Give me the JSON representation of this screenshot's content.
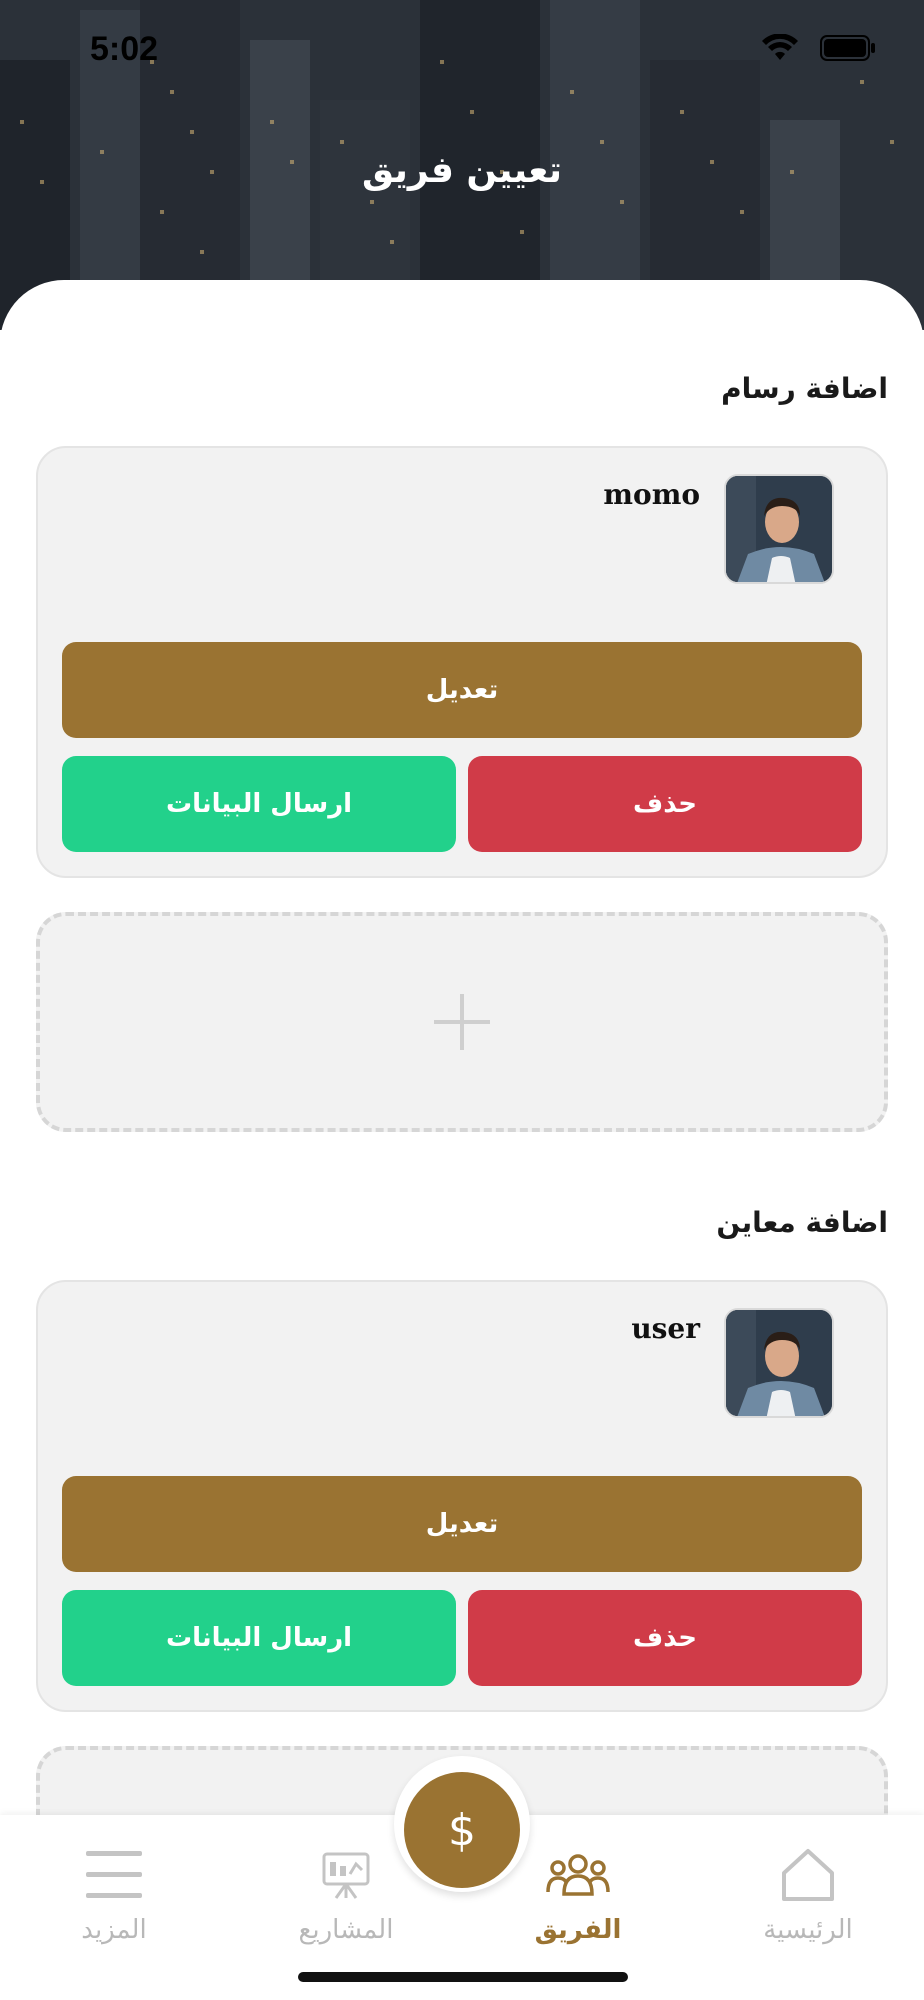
{
  "status_bar": {
    "time": "5:02"
  },
  "header": {
    "title": "تعيين فريق"
  },
  "sections": [
    {
      "title": "اضافة رسام",
      "member": {
        "name": "momo",
        "edit_label": "تعديل",
        "send_label": "ارسال البيانات",
        "delete_label": "حذف"
      }
    },
    {
      "title": "اضافة معاين",
      "member": {
        "name": "user",
        "edit_label": "تعديل",
        "send_label": "ارسال البيانات",
        "delete_label": "حذف"
      }
    }
  ],
  "bottom_nav": {
    "items": [
      {
        "label": "المزيد",
        "icon": "menu-icon"
      },
      {
        "label": "المشاريع",
        "icon": "projects-icon"
      },
      {
        "label": "الفريق",
        "icon": "team-icon",
        "active": true
      },
      {
        "label": "الرئيسية",
        "icon": "home-icon"
      }
    ],
    "fab_symbol": "$"
  },
  "colors": {
    "accent": "#9a7332",
    "send": "#22d18b",
    "delete": "#d03b48",
    "inactive_nav": "#b8b8b8"
  }
}
